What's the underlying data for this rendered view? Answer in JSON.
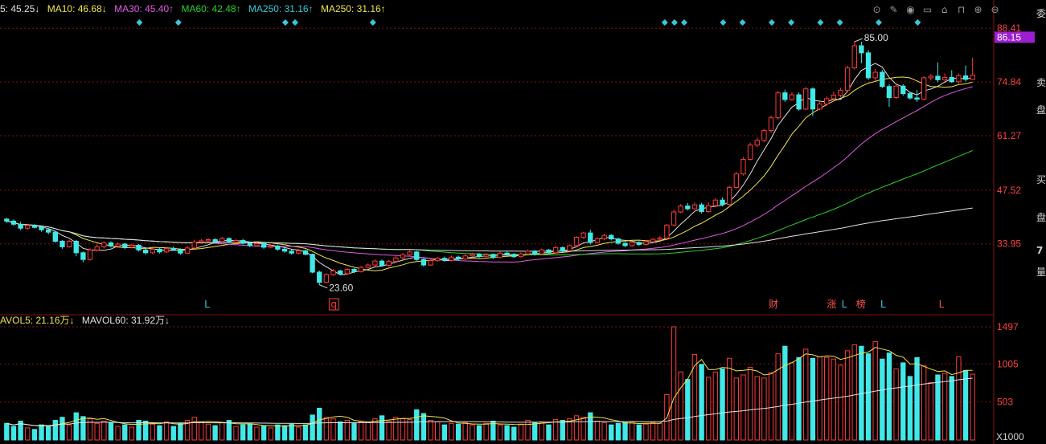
{
  "ma_legend": [
    {
      "label": "5: 45.25",
      "arrow": "↓",
      "color": "#e0e0e0"
    },
    {
      "label": "MA10: 46.68",
      "arrow": "↓",
      "color": "#f0e54a"
    },
    {
      "label": "MA30: 45.40",
      "arrow": "↑",
      "color": "#e15be6"
    },
    {
      "label": "MA60: 42.48",
      "arrow": "↑",
      "color": "#28d128"
    },
    {
      "label": "MA250: 31.16",
      "arrow": "↑",
      "color": "#35c9d8"
    },
    {
      "label": "MA250: 31.16",
      "arrow": "↑",
      "color": "#f0e54a"
    }
  ],
  "vol_legend": [
    {
      "label": "AVOL5: 21.16万",
      "arrow": "↓",
      "color": "#f0e54a"
    },
    {
      "label": "MAVOL60: 31.92万",
      "arrow": "↓",
      "color": "#e0e0e0"
    }
  ],
  "toolbar": [
    {
      "name": "target-icon",
      "glyph": "⊙"
    },
    {
      "name": "pen-icon",
      "glyph": "✎"
    },
    {
      "name": "eye-icon",
      "glyph": "◉"
    },
    {
      "name": "window-icon",
      "glyph": "▭"
    },
    {
      "name": "stamp-icon",
      "glyph": "⌂"
    },
    {
      "name": "lock-icon",
      "glyph": "⊓"
    },
    {
      "name": "zoom-in-icon",
      "glyph": "⊕"
    },
    {
      "name": "zoom-out-icon",
      "glyph": "⊖"
    }
  ],
  "price_axis": {
    "ticks": [
      "88.41",
      "74.84",
      "61.27",
      "47.52",
      "33.95"
    ],
    "current": "86.15",
    "current_bg": "#9b1fd1"
  },
  "vol_axis": {
    "ticks": [
      "1497",
      "1005",
      "503"
    ],
    "unit": "X1000"
  },
  "annotations": {
    "high": "85.00",
    "low": "23.60"
  },
  "markers": [
    {
      "text": "L",
      "color": "#35c9d8"
    },
    {
      "text": "q",
      "color": "#ff3a3a",
      "boxed": true
    },
    {
      "text": "财",
      "color": "#ff5050"
    },
    {
      "text": "涨",
      "color": "#ff5050"
    },
    {
      "text": "L",
      "color": "#35c9d8"
    },
    {
      "text": "榜",
      "color": "#ff5050"
    },
    {
      "text": "L",
      "color": "#35c9d8"
    },
    {
      "text": "L",
      "color": "#ff5050"
    }
  ],
  "right_panel": [
    "委",
    "卖",
    "盘",
    "买",
    "盘",
    "7",
    "量"
  ],
  "colors": {
    "up": "#ff3a3a",
    "down": "#40e8e8",
    "grid": "#8a1010",
    "background": "#000000"
  },
  "chart_data": {
    "type": "candlestick",
    "price_range": [
      20.5,
      91.5
    ],
    "volume_max": 1497,
    "candles": [
      [
        40.2,
        39.7,
        40.5,
        39.2,
        220
      ],
      [
        39.7,
        38.9,
        40.1,
        38.5,
        180
      ],
      [
        38.9,
        37.9,
        39.5,
        37.4,
        250
      ],
      [
        37.9,
        38.6,
        39.0,
        37.5,
        160
      ],
      [
        38.6,
        38.1,
        39.0,
        37.8,
        140
      ],
      [
        38.1,
        37.5,
        38.6,
        37.0,
        200
      ],
      [
        37.5,
        36.9,
        37.9,
        36.4,
        190
      ],
      [
        36.9,
        34.6,
        37.2,
        34.2,
        260
      ],
      [
        34.6,
        33.2,
        34.9,
        32.7,
        300
      ],
      [
        33.2,
        34.6,
        35.0,
        33.0,
        200
      ],
      [
        34.6,
        31.7,
        34.9,
        30.8,
        360
      ],
      [
        31.7,
        30.0,
        32.0,
        29.3,
        310
      ],
      [
        30.0,
        32.4,
        32.8,
        29.7,
        280
      ],
      [
        32.4,
        33.2,
        33.8,
        32.0,
        220
      ],
      [
        33.2,
        34.2,
        34.6,
        32.8,
        250
      ],
      [
        34.2,
        33.4,
        34.6,
        33.0,
        230
      ],
      [
        33.4,
        33.9,
        34.4,
        33.0,
        180
      ],
      [
        33.9,
        33.1,
        34.2,
        32.6,
        200
      ],
      [
        33.1,
        33.6,
        34.0,
        32.8,
        170
      ],
      [
        33.6,
        32.4,
        33.9,
        32.0,
        260
      ],
      [
        32.4,
        31.7,
        32.8,
        31.2,
        250
      ],
      [
        31.7,
        32.6,
        33.0,
        31.3,
        210
      ],
      [
        32.6,
        31.9,
        32.9,
        31.5,
        190
      ],
      [
        31.9,
        32.8,
        33.2,
        31.6,
        240
      ],
      [
        32.8,
        32.5,
        33.3,
        32.2,
        180
      ],
      [
        32.5,
        31.6,
        32.8,
        31.2,
        220
      ],
      [
        31.6,
        32.9,
        33.4,
        31.4,
        260
      ],
      [
        32.9,
        34.4,
        35.0,
        32.7,
        300
      ],
      [
        34.4,
        34.7,
        35.2,
        34.0,
        240
      ],
      [
        34.7,
        35.0,
        35.4,
        34.3,
        210
      ],
      [
        35.0,
        34.5,
        35.4,
        34.1,
        190
      ],
      [
        34.5,
        35.3,
        35.7,
        34.2,
        230
      ],
      [
        35.3,
        34.4,
        35.6,
        34.1,
        260
      ],
      [
        34.4,
        34.8,
        35.1,
        34.0,
        180
      ],
      [
        34.8,
        34.1,
        35.2,
        33.8,
        200
      ],
      [
        34.1,
        33.5,
        34.5,
        33.1,
        210
      ],
      [
        33.5,
        34.0,
        34.4,
        33.2,
        170
      ],
      [
        34.0,
        33.1,
        34.3,
        32.7,
        190
      ],
      [
        33.1,
        33.4,
        33.8,
        32.8,
        160
      ],
      [
        33.4,
        32.6,
        33.7,
        32.2,
        200
      ],
      [
        32.6,
        32.1,
        33.0,
        31.7,
        190
      ],
      [
        32.1,
        31.6,
        32.5,
        31.2,
        210
      ],
      [
        31.6,
        32.2,
        32.6,
        31.3,
        170
      ],
      [
        32.2,
        31.3,
        32.5,
        31.0,
        200
      ],
      [
        31.3,
        26.8,
        31.5,
        26.5,
        330
      ],
      [
        26.8,
        24.2,
        27.2,
        23.6,
        420
      ],
      [
        24.2,
        26.2,
        26.6,
        24.0,
        300
      ],
      [
        26.2,
        27.1,
        27.6,
        25.8,
        280
      ],
      [
        27.1,
        26.4,
        27.4,
        26.0,
        240
      ],
      [
        26.4,
        27.5,
        27.9,
        26.1,
        260
      ],
      [
        27.5,
        26.9,
        27.8,
        26.5,
        220
      ],
      [
        26.9,
        28.0,
        28.4,
        26.7,
        240
      ],
      [
        28.0,
        28.6,
        29.0,
        27.7,
        230
      ],
      [
        28.6,
        29.6,
        30.0,
        28.2,
        280
      ],
      [
        29.6,
        28.5,
        30.0,
        28.2,
        320
      ],
      [
        28.5,
        29.5,
        29.9,
        28.1,
        250
      ],
      [
        29.5,
        30.4,
        30.9,
        29.2,
        300
      ],
      [
        30.4,
        31.2,
        31.6,
        30.0,
        280
      ],
      [
        31.2,
        31.9,
        32.3,
        30.8,
        270
      ],
      [
        31.9,
        30.0,
        32.2,
        29.6,
        400
      ],
      [
        30.0,
        28.6,
        30.3,
        28.2,
        350
      ],
      [
        28.6,
        29.7,
        30.0,
        28.4,
        260
      ],
      [
        29.7,
        30.3,
        30.7,
        29.4,
        240
      ],
      [
        30.3,
        29.8,
        30.7,
        29.5,
        200
      ],
      [
        29.8,
        30.6,
        31.0,
        29.5,
        220
      ],
      [
        30.6,
        30.1,
        31.0,
        29.7,
        210
      ],
      [
        30.1,
        30.9,
        31.3,
        29.8,
        230
      ],
      [
        30.9,
        31.3,
        31.7,
        30.5,
        200
      ],
      [
        31.3,
        30.8,
        31.6,
        30.4,
        190
      ],
      [
        30.8,
        31.2,
        31.6,
        30.5,
        220
      ],
      [
        31.2,
        30.5,
        31.5,
        30.1,
        250
      ],
      [
        30.5,
        31.6,
        32.0,
        30.3,
        200
      ],
      [
        31.6,
        31.3,
        32.0,
        30.9,
        190
      ],
      [
        31.3,
        30.7,
        31.6,
        30.4,
        170
      ],
      [
        30.7,
        31.4,
        31.8,
        30.5,
        210
      ],
      [
        31.4,
        32.1,
        32.5,
        31.0,
        260
      ],
      [
        32.1,
        31.4,
        32.4,
        31.0,
        230
      ],
      [
        31.4,
        32.4,
        32.8,
        31.1,
        240
      ],
      [
        32.4,
        31.7,
        32.7,
        31.4,
        200
      ],
      [
        31.7,
        33.0,
        33.4,
        31.5,
        270
      ],
      [
        33.0,
        32.2,
        33.3,
        31.8,
        260
      ],
      [
        32.2,
        33.5,
        33.8,
        32.0,
        280
      ],
      [
        33.5,
        35.6,
        35.9,
        33.1,
        320
      ],
      [
        35.6,
        36.7,
        37.0,
        35.2,
        300
      ],
      [
        36.7,
        34.3,
        37.5,
        33.8,
        360
      ],
      [
        34.3,
        35.2,
        35.6,
        34.0,
        250
      ],
      [
        35.2,
        36.1,
        36.5,
        34.8,
        230
      ],
      [
        36.1,
        35.2,
        36.4,
        34.8,
        200
      ],
      [
        35.2,
        34.1,
        35.5,
        33.7,
        220
      ],
      [
        34.1,
        33.5,
        34.4,
        33.1,
        230
      ],
      [
        33.5,
        34.3,
        34.7,
        33.2,
        240
      ],
      [
        34.3,
        33.8,
        34.6,
        33.4,
        200
      ],
      [
        33.8,
        34.5,
        34.9,
        33.5,
        210
      ],
      [
        34.5,
        35.1,
        35.4,
        34.2,
        230
      ],
      [
        35.1,
        35.4,
        35.9,
        34.8,
        220
      ],
      [
        35.4,
        38.7,
        39.0,
        35.2,
        600
      ],
      [
        38.7,
        42.0,
        42.6,
        38.4,
        1497
      ],
      [
        42.0,
        43.5,
        44.0,
        41.7,
        900
      ],
      [
        43.5,
        42.8,
        44.3,
        42.4,
        800
      ],
      [
        42.8,
        43.8,
        44.4,
        42.5,
        1130
      ],
      [
        43.8,
        42.1,
        44.3,
        41.6,
        1000
      ],
      [
        42.1,
        43.6,
        44.4,
        41.8,
        830
      ],
      [
        43.6,
        45.0,
        45.5,
        43.2,
        900
      ],
      [
        45.0,
        43.9,
        45.7,
        43.4,
        940
      ],
      [
        43.9,
        48.2,
        48.7,
        43.7,
        1080
      ],
      [
        48.2,
        51.6,
        52.2,
        47.9,
        820
      ],
      [
        51.6,
        55.3,
        55.9,
        51.2,
        860
      ],
      [
        55.3,
        58.9,
        59.5,
        55.0,
        960
      ],
      [
        58.9,
        60.1,
        60.8,
        58.4,
        840
      ],
      [
        60.1,
        62.6,
        63.0,
        59.6,
        820
      ],
      [
        62.6,
        65.8,
        66.4,
        62.0,
        890
      ],
      [
        65.8,
        72.1,
        72.6,
        65.3,
        1140
      ],
      [
        72.1,
        70.4,
        72.9,
        69.8,
        1240
      ],
      [
        70.4,
        71.6,
        72.3,
        70.1,
        1020
      ],
      [
        71.6,
        68.0,
        72.2,
        67.6,
        1090
      ],
      [
        68.0,
        73.1,
        73.6,
        67.7,
        1200
      ],
      [
        73.1,
        68.0,
        73.5,
        66.2,
        1080
      ],
      [
        68.0,
        69.3,
        70.0,
        67.7,
        1100
      ],
      [
        69.3,
        70.6,
        71.2,
        68.8,
        1090
      ],
      [
        70.6,
        71.5,
        72.4,
        70.2,
        1070
      ],
      [
        71.5,
        72.7,
        73.4,
        71.0,
        990
      ],
      [
        72.7,
        78.4,
        79.0,
        72.5,
        1180
      ],
      [
        78.4,
        84.0,
        85.0,
        78.0,
        1260
      ],
      [
        84.0,
        82.2,
        85.0,
        79.6,
        1240
      ],
      [
        82.2,
        75.9,
        82.9,
        75.4,
        1140
      ],
      [
        75.9,
        77.3,
        78.1,
        75.0,
        1300
      ],
      [
        77.3,
        73.7,
        77.9,
        73.3,
        1070
      ],
      [
        73.7,
        70.9,
        74.3,
        68.6,
        1150
      ],
      [
        70.9,
        73.8,
        74.3,
        70.5,
        940
      ],
      [
        73.8,
        71.9,
        74.3,
        71.4,
        1020
      ],
      [
        71.9,
        70.8,
        72.3,
        70.4,
        840
      ],
      [
        70.8,
        70.5,
        72.8,
        69.8,
        1090
      ],
      [
        70.5,
        75.9,
        76.3,
        70.3,
        980
      ],
      [
        75.9,
        76.3,
        76.9,
        75.2,
        760
      ],
      [
        76.3,
        75.4,
        79.8,
        74.8,
        860
      ],
      [
        75.4,
        76.0,
        77.0,
        74.9,
        880
      ],
      [
        76.0,
        74.9,
        77.8,
        74.6,
        840
      ],
      [
        74.9,
        76.4,
        77.0,
        74.5,
        1100
      ],
      [
        76.4,
        75.5,
        79.0,
        75.0,
        920
      ],
      [
        75.5,
        76.6,
        81.0,
        76.0,
        870
      ]
    ],
    "ma_series": [
      {
        "name": "MA5",
        "color": "#e0e0e0"
      },
      {
        "name": "MA10",
        "color": "#f0e54a"
      },
      {
        "name": "MA30",
        "color": "#e15be6"
      },
      {
        "name": "MA60",
        "color": "#28d128"
      },
      {
        "name": "MA250",
        "color": "#e0e0e0"
      }
    ]
  }
}
